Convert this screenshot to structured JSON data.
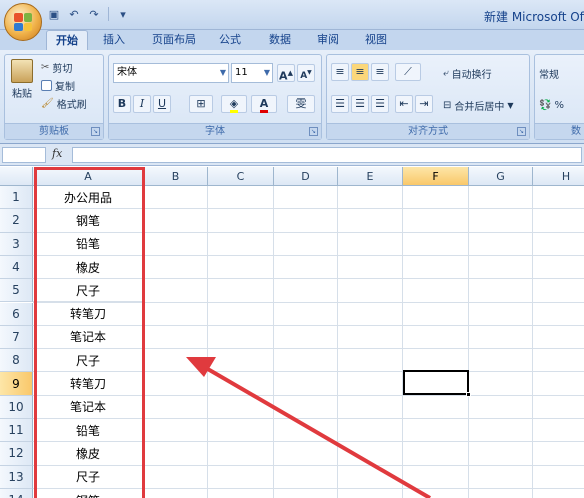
{
  "window": {
    "title": "新建 Microsoft Offi"
  },
  "ribbon": {
    "tabs": [
      "开始",
      "插入",
      "页面布局",
      "公式",
      "数据",
      "审阅",
      "视图"
    ],
    "clipboard": {
      "label": "剪贴板",
      "paste": "粘贴",
      "cut": "剪切",
      "copy": "复制",
      "format_painter": "格式刷"
    },
    "font": {
      "label": "字体",
      "font_name": "宋体",
      "font_size": "11",
      "grow": "A",
      "shrink": "A",
      "bold": "B",
      "italic": "I",
      "underline": "U",
      "text_color": "A",
      "wen": "雯"
    },
    "alignment": {
      "label": "对齐方式",
      "wrap": "自动换行",
      "merge": "合并后居中"
    },
    "number": {
      "format": "常规",
      "percent": "%",
      "label_partial": "数"
    }
  },
  "formula_bar": {
    "fx": "fx",
    "name_box": "",
    "content": ""
  },
  "sheet": {
    "columns": [
      "A",
      "B",
      "C",
      "D",
      "E",
      "F",
      "G",
      "H"
    ],
    "selected_column": "F",
    "selected_row": 9,
    "rows": [
      {
        "n": "1",
        "a": "办公用品"
      },
      {
        "n": "2",
        "a": "钢笔"
      },
      {
        "n": "3",
        "a": "铅笔"
      },
      {
        "n": "4",
        "a": "橡皮"
      },
      {
        "n": "5",
        "a": "尺子"
      },
      {
        "n": "6",
        "a": "转笔刀"
      },
      {
        "n": "7",
        "a": "笔记本"
      },
      {
        "n": "8",
        "a": "尺子"
      },
      {
        "n": "9",
        "a": "转笔刀"
      },
      {
        "n": "10",
        "a": "笔记本"
      },
      {
        "n": "11",
        "a": "铅笔"
      },
      {
        "n": "12",
        "a": "橡皮"
      },
      {
        "n": "13",
        "a": "尺子"
      },
      {
        "n": "14",
        "a": "钢笔"
      }
    ]
  },
  "annotation": {
    "highlight_color": "#e03a3e"
  }
}
